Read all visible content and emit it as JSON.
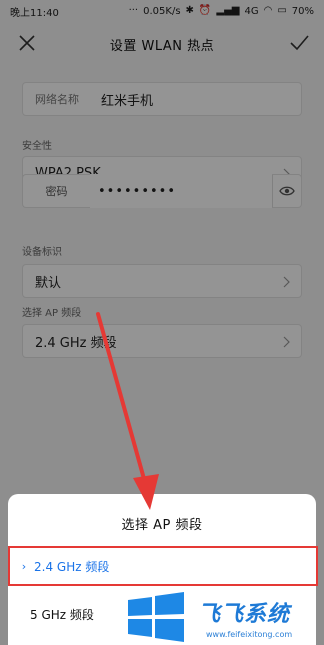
{
  "statusbar": {
    "time": "晚上11:40",
    "net_speed": "0.05K/s",
    "network": "4G",
    "battery": "70%"
  },
  "appbar": {
    "title": "设置 WLAN 热点"
  },
  "form": {
    "ssid_label": "网络名称",
    "ssid_value": "红米手机",
    "security_section": "安全性",
    "security_value": "WPA2 PSK",
    "password_label": "密码",
    "password_value": "•••••••••",
    "device_id_section": "设备标识",
    "device_id_value": "默认",
    "band_section": "选择 AP 频段",
    "band_value": "2.4 GHz 频段"
  },
  "sheet": {
    "title": "选择 AP 频段",
    "options": [
      {
        "label": "2.4 GHz 频段",
        "selected": true
      },
      {
        "label": "5 GHz 频段",
        "selected": false
      }
    ]
  },
  "watermark": {
    "brand": "飞飞系统",
    "url": "www.feifeixitong.com"
  },
  "colors": {
    "accent": "#1a73e8",
    "highlight_border": "#e53935",
    "arrow": "#e53935",
    "watermark": "#1e7ad6"
  }
}
